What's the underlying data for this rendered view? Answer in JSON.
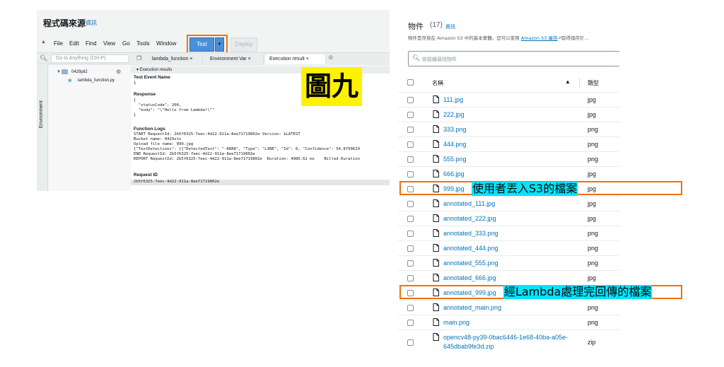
{
  "lambda": {
    "code_title": "程式碼來源",
    "info_link": "資訊",
    "menu": [
      "File",
      "Edit",
      "Find",
      "View",
      "Go",
      "Tools",
      "Window"
    ],
    "test_label": "Test",
    "deploy_label": "Deploy",
    "goto_placeholder": "Go to Anything (Ctrl-P)",
    "environment_label": "Environment",
    "tree_folder": "0429pil2",
    "tree_file": "lambda_function.py",
    "tabs": [
      "lambda_function",
      "Environment Var",
      "Execution result"
    ],
    "exec_header": "Execution results",
    "test_event_label": "Test Event Name",
    "test_event_value": "1",
    "response_label": "Response",
    "response_lines": [
      "{",
      "  \"statusCode\": 200,",
      "  \"body\": \"\\\"Hello from Lambda!\\\"\"",
      "}"
    ],
    "logs_label": "Function Logs",
    "log_lines": [
      "START RequestId: 2b5f6325-7eec-4d22-911a-8ee71719802e Version: $LATEST",
      "Bucket name: 0429sto",
      "Upload file name: 999.jpg",
      "{\"TextDetections\": [{\"DetectedText\": \"-8888\", \"Type\": \"LINE\", \"Id\": 0, \"Confidence\": 54.8799629",
      "END RequestId: 2b5f6325-7eec-4d22-911a-8ee71719802e",
      "REPORT RequestId: 2b5f6325-7eec-4d22-911a-8ee71719802e  Duration: 4986.62 ms    Billed Duration"
    ],
    "request_id_label": "Request ID",
    "request_id_value": "2b5f6325-7eec-4d22-911a-8ee71719802e",
    "figure_label": "圖九"
  },
  "s3": {
    "title": "物件",
    "count": "(17)",
    "info_link": "資訊",
    "desc_before": "物件是存放在 Amazon S3 中的基本實體。您可以使用 ",
    "desc_link": "Amazon S3 庫存",
    "desc_after": "取得儲存於...",
    "search_placeholder": "依前綴尋找物件",
    "col_name": "名稱",
    "col_type": "類型",
    "rows": [
      {
        "name": "111.jpg",
        "type": "jpg"
      },
      {
        "name": "222.jpg",
        "type": "jpg"
      },
      {
        "name": "333.png",
        "type": "png"
      },
      {
        "name": "444.png",
        "type": "png"
      },
      {
        "name": "555.png",
        "type": "png"
      },
      {
        "name": "666.jpg",
        "type": "jpg"
      },
      {
        "name": "999.jpg",
        "type": "jpg"
      },
      {
        "name": "annotated_111.jpg",
        "type": "jpg"
      },
      {
        "name": "annotated_222.jpg",
        "type": "jpg"
      },
      {
        "name": "annotated_333.png",
        "type": "png"
      },
      {
        "name": "annotated_444.png",
        "type": "png"
      },
      {
        "name": "annotated_555.png",
        "type": "png"
      },
      {
        "name": "annotated_666.jpg",
        "type": "jpg"
      },
      {
        "name": "annotated_999.jpg",
        "type": "jpg"
      },
      {
        "name": "annotated_main.png",
        "type": "png"
      },
      {
        "name": "main.png",
        "type": "png"
      },
      {
        "name": "opencv48-py39-0bac6446-1e68-40ba-a05e-645dbab9fe3d.zip",
        "type": "zip"
      }
    ],
    "annotation_upload": "使用者丟入S3的檔案",
    "annotation_processed": "經Lambda處理完回傳的檔案"
  },
  "colors": {
    "highlight_border": "#ec7211",
    "annotation_bg": "#00e5ff",
    "figure_bg": "#fff200",
    "link": "#0073bb"
  }
}
